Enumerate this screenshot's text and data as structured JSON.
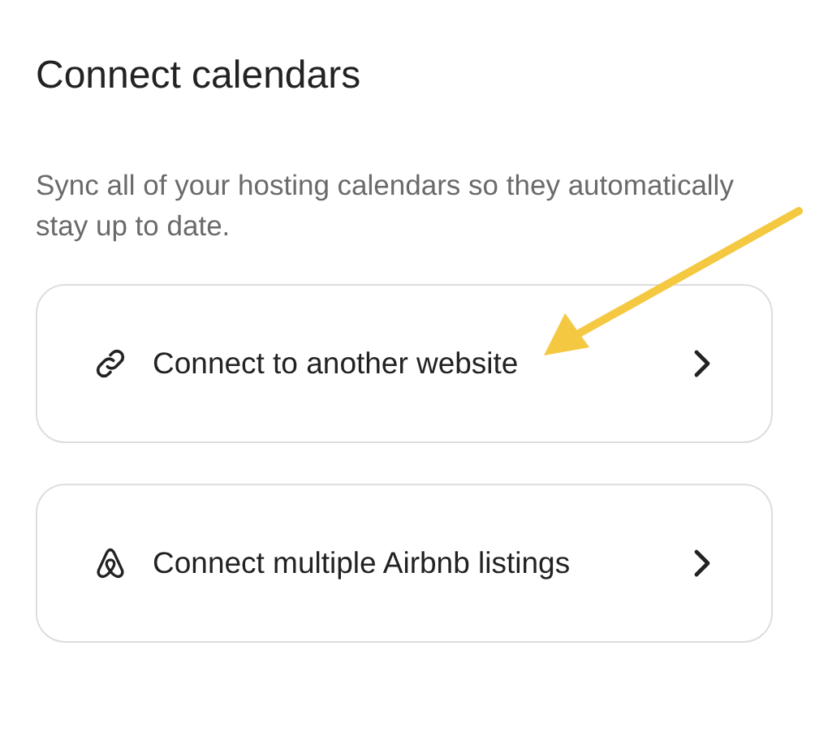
{
  "title": "Connect calendars",
  "description": "Sync all of your hosting calendars so they automatically stay up to date.",
  "options": [
    {
      "kind": "link",
      "label": "Connect to another website"
    },
    {
      "kind": "listings",
      "label": "Connect multiple Airbnb listings"
    }
  ]
}
